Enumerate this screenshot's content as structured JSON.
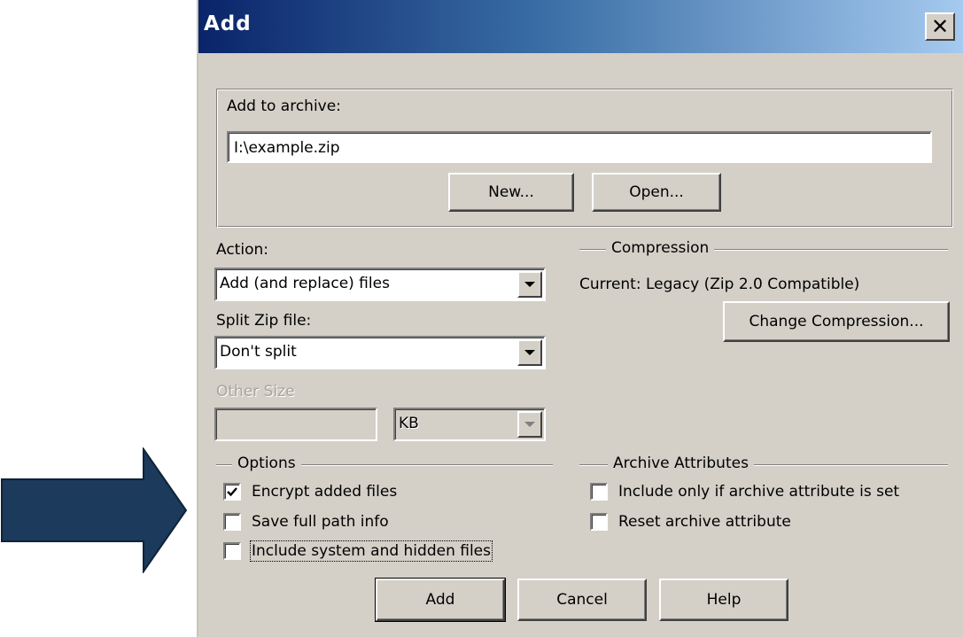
{
  "dialog": {
    "title": "Add",
    "close_glyph": "✕"
  },
  "archive": {
    "label": "Add to archive:",
    "path": "I:\\example.zip",
    "new_button": "New...",
    "open_button": "Open..."
  },
  "action": {
    "label": "Action:",
    "selected": "Add (and replace) files"
  },
  "split": {
    "label": "Split Zip file:",
    "selected": "Don't split"
  },
  "other_size": {
    "label": "Other Size",
    "value": "",
    "unit": "KB"
  },
  "compression": {
    "heading": "Compression",
    "current": "Current: Legacy (Zip 2.0 Compatible)",
    "change_button": "Change Compression..."
  },
  "options": {
    "heading": "Options",
    "items": [
      {
        "label": "Encrypt added files",
        "checked": true
      },
      {
        "label": "Save full path info",
        "checked": false
      },
      {
        "label": "Include system and hidden files",
        "checked": false
      }
    ]
  },
  "archive_attributes": {
    "heading": "Archive Attributes",
    "items": [
      {
        "label": "Include only if archive attribute is set",
        "checked": false
      },
      {
        "label": "Reset archive attribute",
        "checked": false
      }
    ]
  },
  "buttons": {
    "add": "Add",
    "cancel": "Cancel",
    "help": "Help"
  },
  "annotation": {
    "arrow_color": "#1b3a5c",
    "arrow_icon": "right-arrow-icon"
  }
}
